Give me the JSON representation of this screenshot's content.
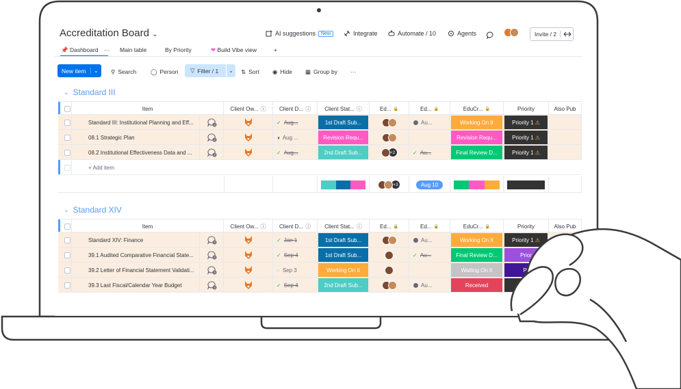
{
  "header": {
    "board_title": "Accreditation Board",
    "ai_label": "AI suggestions",
    "ai_badge": "New",
    "integrate": "Integrate",
    "automate": "Automate / 10",
    "agents": "Agents",
    "invite": "Invite / 2"
  },
  "tabs": [
    "Dashboard",
    "Main table",
    "By Priority",
    "Build Vibe view"
  ],
  "toolbar": {
    "new_item": "New item",
    "search": "Search",
    "person": "Person",
    "filter": "Filter / 1",
    "sort": "Sort",
    "hide": "Hide",
    "group_by": "Group by"
  },
  "columns": [
    "Item",
    "Client Ow...",
    "Client D...",
    "Client Stat...",
    "Ed...",
    "Ed...",
    "EduCr...",
    "Priority",
    "Also Pub"
  ],
  "groups": [
    {
      "title": "Standard III",
      "color": "#579bfc",
      "rows": [
        {
          "item": "Standard III: Institutional Planning and Eff...",
          "cdate": "Aug...",
          "cdate_state": "check-strike",
          "status": "1st Draft Sub...",
          "status_color": "#0a6fa8",
          "editors": [
            "a",
            "b"
          ],
          "ed2": "Au...",
          "ed2_state": "dot",
          "edu": "Working On It",
          "edu_color": "#fdab3d",
          "priority": "Priority 1",
          "priority_color": "#333333",
          "warn": true
        },
        {
          "item": "08.1 Strategic Plan",
          "cdate": "Aug ...",
          "cdate_state": "half",
          "status": "Revision Requ...",
          "status_color": "#ff5ac4",
          "editors": [
            "a",
            "b"
          ],
          "ed2": "",
          "ed2_state": "none",
          "edu": "Revision Requ...",
          "edu_color": "#ff5ac4",
          "priority": "Priority 1",
          "priority_color": "#333333",
          "warn": true
        },
        {
          "item": "08.2 Institutional Effectiveness Data and ...",
          "cdate": "Aug...",
          "cdate_state": "check-strike",
          "status": "2nd Draft Sub...",
          "status_color": "#4eccc6",
          "editors": [
            "a",
            "+2"
          ],
          "ed2": "Au...",
          "ed2_state": "check-strike",
          "edu": "Final Review D...",
          "edu_color": "#00c875",
          "priority": "Priority 1",
          "priority_color": "#333333",
          "warn": true
        }
      ],
      "add_item": "+ Add item",
      "summary": {
        "editors_extra": "+3",
        "date_badge": "Aug 10"
      }
    },
    {
      "title": "Standard XIV",
      "color": "#579bfc",
      "rows": [
        {
          "item": "Standard XIV: Finance",
          "cdate": "Jan 1",
          "cdate_state": "check-strike",
          "status": "1st Draft Sub...",
          "status_color": "#0a6fa8",
          "editors": [
            "a",
            "b"
          ],
          "ed2": "Au...",
          "ed2_state": "dot",
          "edu": "Working On It",
          "edu_color": "#fdab3d",
          "priority": "Priority 1",
          "priority_color": "#333333",
          "warn": true
        },
        {
          "item": "39.1 Audited Comparative Financial State...",
          "cdate": "Sep 4",
          "cdate_state": "check-strike",
          "status": "1st Draft Sub...",
          "status_color": "#0a6fa8",
          "editors": [
            "a"
          ],
          "ed2": "Au...",
          "ed2_state": "check-strike",
          "edu": "Final Review D...",
          "edu_color": "#00c875",
          "priority": "Prior",
          "priority_color": "#9d50dd",
          "warn": false
        },
        {
          "item": "39.2 Letter of Financial Statement Validati...",
          "cdate": "Sep 3",
          "cdate_state": "circle",
          "status": "Working On It",
          "status_color": "#fdab3d",
          "editors": [
            "a"
          ],
          "ed2": "",
          "ed2_state": "none",
          "edu": "Waiting On It",
          "edu_color": "#c4c4c4",
          "priority": "Pr",
          "priority_color": "#401694",
          "warn": false
        },
        {
          "item": "39.3 Last Fiscal/Calendar Year Budget",
          "cdate": "Sep 4",
          "cdate_state": "check-strike",
          "status": "2nd Draft Sub...",
          "status_color": "#4eccc6",
          "editors": [
            "a",
            "b"
          ],
          "ed2": "Au...",
          "ed2_state": "dot",
          "edu": "Received",
          "edu_color": "#e2445c",
          "priority": "P",
          "priority_color": "#333333",
          "warn": false
        }
      ]
    }
  ],
  "colors": {
    "accent": "#0073ea",
    "group": "#579bfc",
    "row_bg": "#fbeee0"
  }
}
